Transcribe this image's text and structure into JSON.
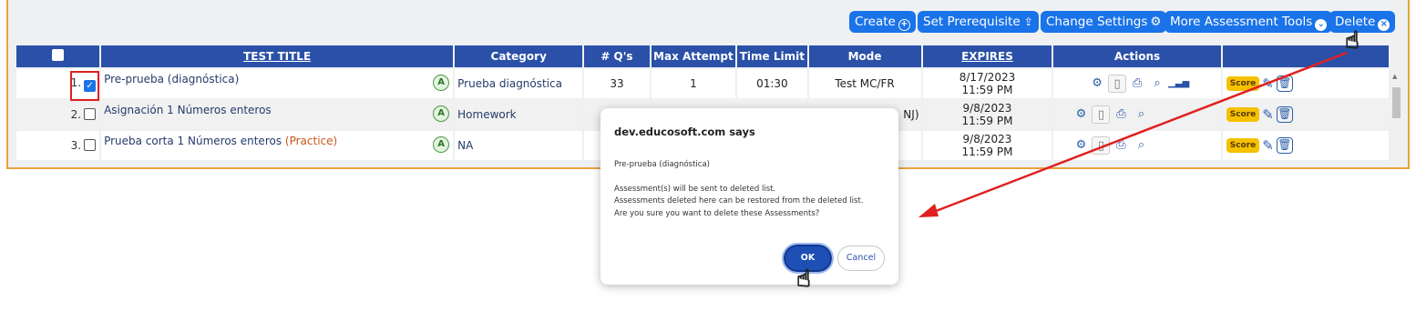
{
  "toolbar": {
    "create": "Create",
    "set_prerequisite": "Set Prerequisite",
    "change_settings": "Change Settings",
    "more_tools": "More Assessment Tools",
    "delete": "Delete"
  },
  "table": {
    "headers": [
      "TEST TITLE",
      "Category",
      "# Q's",
      "Max Attempt",
      "Time Limit",
      "Mode",
      "EXPIRES",
      "Actions"
    ],
    "rows": [
      {
        "num": "1.",
        "title": "Pre-prueba (diagnóstica)",
        "practice": "",
        "category": "Prueba diagnóstica",
        "questions": "33",
        "max_attempt": "1",
        "time_limit": "01:30",
        "mode": "Test MC/FR",
        "expires_date": "8/17/2023",
        "expires_time": "11:59 PM",
        "checked": true
      },
      {
        "num": "2.",
        "title": "Asignación 1 Números enteros",
        "practice": "",
        "category": "Homework",
        "questions": "",
        "max_attempt": "",
        "time_limit": "",
        "mode": "NJ)",
        "expires_date": "9/8/2023",
        "expires_time": "11:59 PM",
        "checked": false
      },
      {
        "num": "3.",
        "title": "Prueba corta 1 Números enteros",
        "practice": "(Practice)",
        "category": "NA",
        "questions": "",
        "max_attempt": "",
        "time_limit": "",
        "mode": "",
        "expires_date": "9/8/2023",
        "expires_time": "11:59 PM",
        "checked": false
      }
    ],
    "badge_letter": "A",
    "score_label": "Score"
  },
  "dialog": {
    "title": "dev.educosoft.com says",
    "line1": "Pre-prueba (diagnóstica)",
    "line2": "Assessment(s) will be sent to deleted list.",
    "line3": "Assessments deleted here can be restored from the deleted list.",
    "line4": "Are you sure you want to delete these Assessments?",
    "ok": "OK",
    "cancel": "Cancel"
  },
  "colors": {
    "toolbar_button": "#1a73e8",
    "table_header": "#2a50a8",
    "annotation_red": "#e02020",
    "ok_button": "#1d4fb5",
    "score_badge": "#f5c100"
  },
  "icons": [
    "plus-circle-icon",
    "share-icon",
    "gear-icon",
    "chevron-circle-icon",
    "x-circle-icon",
    "document-icon",
    "print-icon",
    "magnifier-icon",
    "bar-chart-icon",
    "pencil-icon",
    "trash-icon",
    "hand-pointer-icon"
  ]
}
